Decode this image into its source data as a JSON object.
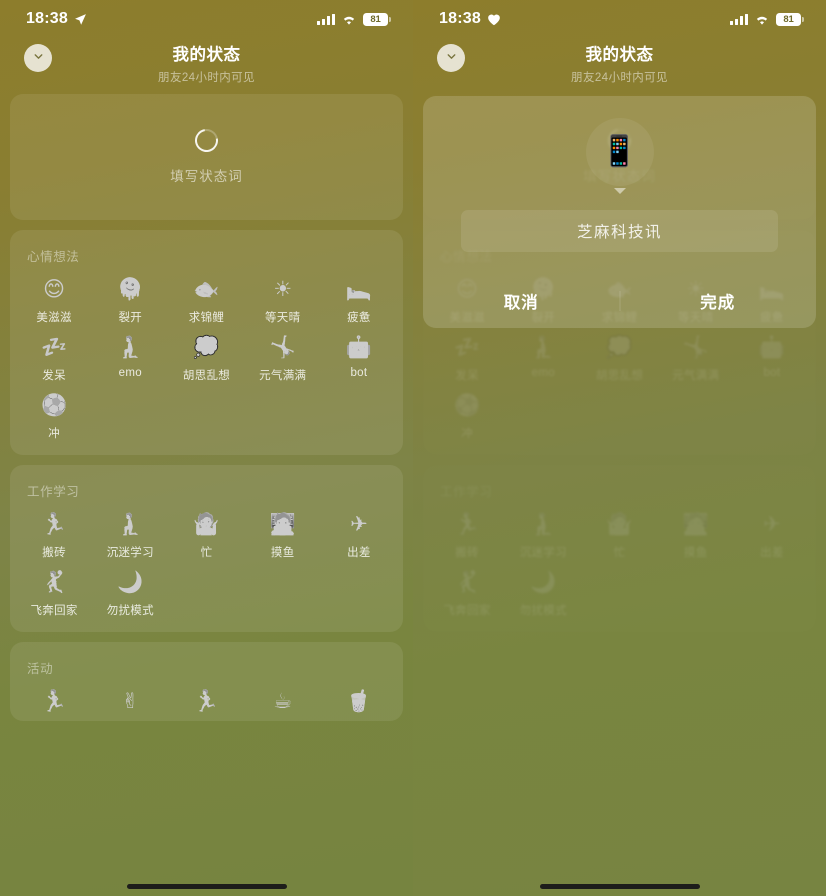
{
  "status_bar": {
    "time": "18:38",
    "left_icon_left_panel": "location-arrow-icon",
    "left_icon_right_panel": "heart-icon",
    "battery_level": "81",
    "signal_icon": "cellular-signal-icon",
    "wifi_icon": "wifi-icon"
  },
  "header": {
    "title": "我的状态",
    "subtitle": "朋友24小时内可见",
    "collapse_icon": "chevron-down-icon"
  },
  "status_input": {
    "icon": "ring-circle-icon",
    "placeholder": "填写状态词"
  },
  "sections": [
    {
      "title": "心情想法",
      "items": [
        {
          "label": "美滋滋",
          "icon": "smiling-face-icon"
        },
        {
          "label": "裂开",
          "icon": "cracked-face-icon"
        },
        {
          "label": "求锦鲤",
          "icon": "koi-fish-icon"
        },
        {
          "label": "等天晴",
          "icon": "sun-icon"
        },
        {
          "label": "疲惫",
          "icon": "tired-person-icon"
        },
        {
          "label": "发呆",
          "icon": "daydreaming-person-icon"
        },
        {
          "label": "emo",
          "icon": "sad-person-icon"
        },
        {
          "label": "胡思乱想",
          "icon": "thought-cloud-icon"
        },
        {
          "label": "元气满满",
          "icon": "sparkling-person-icon"
        },
        {
          "label": "bot",
          "icon": "robot-icon"
        },
        {
          "label": "冲",
          "icon": "soccer-rush-icon"
        }
      ]
    },
    {
      "title": "工作学习",
      "items": [
        {
          "label": "搬砖",
          "icon": "carrying-bricks-icon"
        },
        {
          "label": "沉迷学习",
          "icon": "studying-person-icon"
        },
        {
          "label": "忙",
          "icon": "busy-person-icon"
        },
        {
          "label": "摸鱼",
          "icon": "slacking-person-icon"
        },
        {
          "label": "出差",
          "icon": "airplane-icon"
        },
        {
          "label": "飞奔回家",
          "icon": "running-home-icon"
        },
        {
          "label": "勿扰模式",
          "icon": "crescent-moon-icon"
        }
      ]
    },
    {
      "title": "活动",
      "items": [
        {
          "label": "",
          "icon": "running-person-icon"
        },
        {
          "label": "",
          "icon": "victory-hand-icon"
        },
        {
          "label": "",
          "icon": "runner-icon"
        },
        {
          "label": "",
          "icon": "coffee-cup-icon"
        },
        {
          "label": "",
          "icon": "bubble-tea-icon"
        }
      ]
    }
  ],
  "dialog": {
    "avatar_icon": "mobile-phone-icon",
    "caret_icon": "triangle-down-icon",
    "input_value": "芝麻科技讯",
    "cancel_label": "取消",
    "confirm_label": "完成"
  },
  "colors": {
    "background_top": "#8d7d2c",
    "background_bottom": "#768440",
    "card_fill": "rgba(255,255,255,0.085)",
    "text_primary": "#ffffff",
    "home_indicator": "#1d1d1b"
  }
}
